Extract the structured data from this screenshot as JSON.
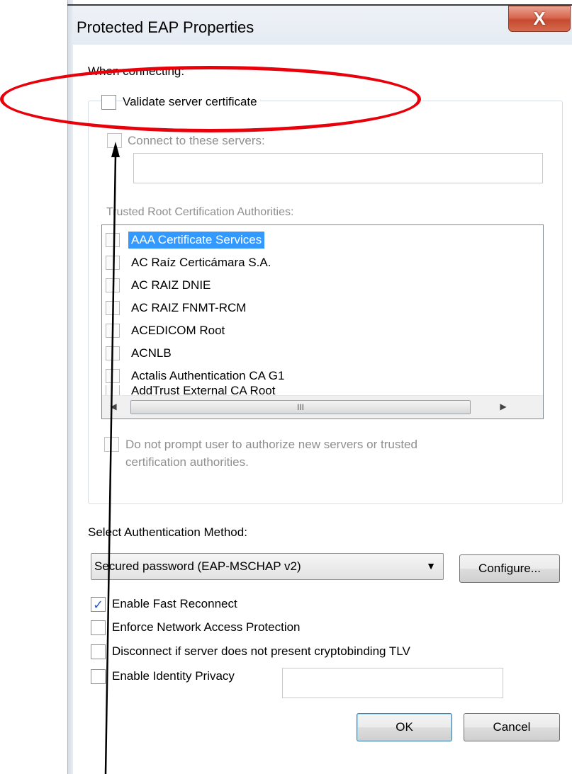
{
  "window": {
    "title": "Protected EAP Properties",
    "close_symbol": "X"
  },
  "connecting": {
    "heading": "When connecting:",
    "validate_label": "Validate server certificate",
    "validate_checked": false,
    "connect_label": "Connect to these servers:",
    "connect_checked": false,
    "servers_value": "",
    "trusted_root_label": "Trusted Root Certification Authorities:",
    "authorities": [
      {
        "name": "AAA Certificate Services",
        "selected": true,
        "checked": false
      },
      {
        "name": "AC Raíz Certicámara S.A.",
        "selected": false,
        "checked": false
      },
      {
        "name": "AC RAIZ DNIE",
        "selected": false,
        "checked": false
      },
      {
        "name": "AC RAIZ FNMT-RCM",
        "selected": false,
        "checked": false
      },
      {
        "name": "ACEDICOM Root",
        "selected": false,
        "checked": false
      },
      {
        "name": "ACNLB",
        "selected": false,
        "checked": false
      },
      {
        "name": "Actalis Authentication CA G1",
        "selected": false,
        "checked": false
      },
      {
        "name": "AddTrust External CA Root",
        "selected": false,
        "checked": false
      }
    ],
    "scrollbar_up": "▲",
    "scrollbar_down": "▼",
    "scrollbar_grip": "≡",
    "scrollbar_left": "◀",
    "scrollbar_right": "▶",
    "hscroll_grip": "III",
    "do_not_prompt_line1": "Do not prompt user to authorize new servers or trusted",
    "do_not_prompt_line2": "certification authorities."
  },
  "auth": {
    "label": "Select Authentication Method:",
    "selected_method": "Secured password (EAP-MSCHAP v2)",
    "dropdown_arrow": "▼",
    "configure_label": "Configure..."
  },
  "options": [
    {
      "label": "Enable Fast Reconnect",
      "checked": true
    },
    {
      "label": "Enforce Network Access Protection",
      "checked": false
    },
    {
      "label": "Disconnect if server does not present cryptobinding TLV",
      "checked": false
    },
    {
      "label": "Enable Identity Privacy",
      "checked": false
    }
  ],
  "identity_value": "",
  "check_mark": "✓",
  "buttons": {
    "ok": "OK",
    "cancel": "Cancel"
  },
  "annotation": {
    "ellipse_color": "#e8000b",
    "arrow_color": "#000000"
  }
}
